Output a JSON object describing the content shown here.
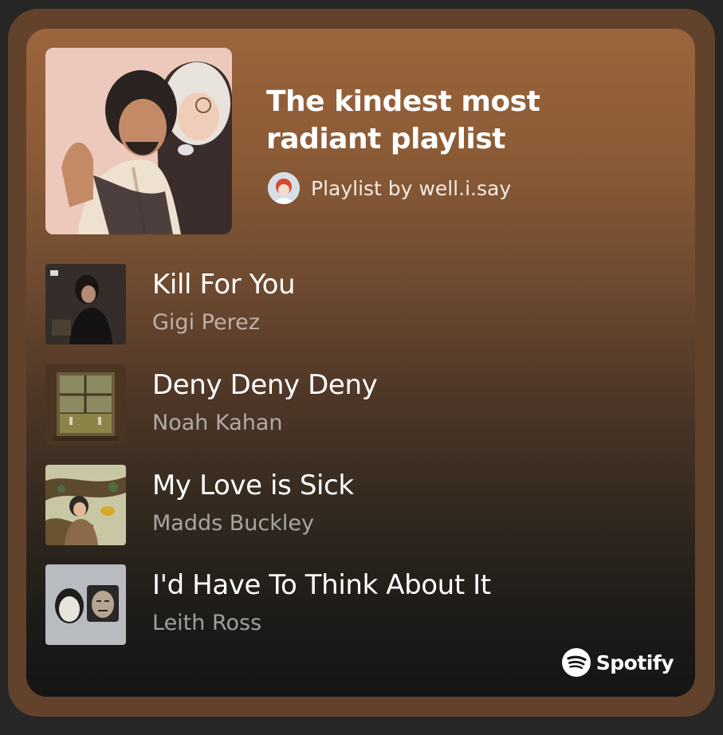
{
  "playlist": {
    "title": "The kindest most radiant playlist",
    "byline": "Playlist by well.i.say",
    "cover_icon": "playlist-cover-art"
  },
  "tracks": [
    {
      "title": "Kill For You",
      "artist": "Gigi Perez",
      "art": "album-art-woman-dark"
    },
    {
      "title": "Deny Deny Deny",
      "artist": "Noah Kahan",
      "art": "album-art-window"
    },
    {
      "title": "My Love is Sick",
      "artist": "Madds Buckley",
      "art": "album-art-tree-illustration"
    },
    {
      "title": "I'd Have To Think About It",
      "artist": "Leith Ross",
      "art": "album-art-two-faces"
    }
  ],
  "brand": {
    "name": "Spotify",
    "icon": "spotify-logo-icon"
  },
  "colors": {
    "gradient_top": "#9c653d",
    "gradient_bottom": "#151515",
    "frame": "#62422b",
    "background": "#262626"
  }
}
